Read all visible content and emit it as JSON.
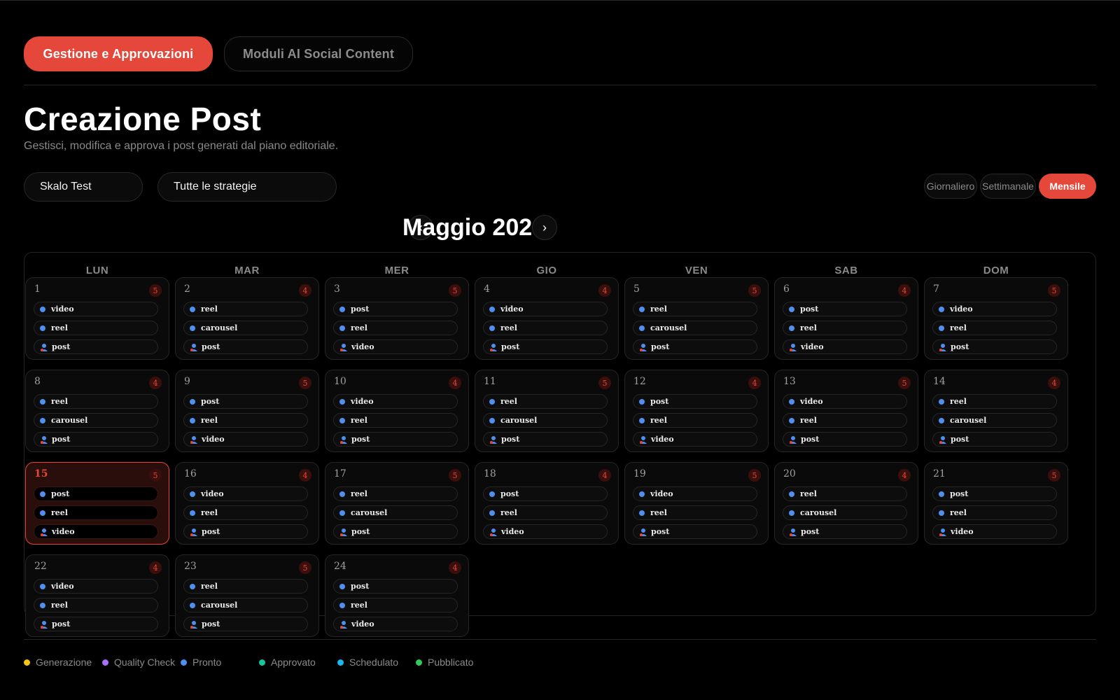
{
  "tabs": [
    {
      "label": "Gestione e Approvazioni",
      "active": true
    },
    {
      "label": "Moduli AI Social Content",
      "active": false
    }
  ],
  "page": {
    "title": "Creazione Post",
    "subtitle": "Gestisci, modifica e approva i post generati dal piano editoriale."
  },
  "filters": {
    "client": "Skalo Test",
    "strategy": "Tutte le strategie"
  },
  "views": {
    "day": "Giornaliero",
    "week": "Settimanale",
    "month": "Mensile",
    "selected": "month"
  },
  "calendar": {
    "month_title": "Maggio 2026",
    "prev_symbol": "‹",
    "next_symbol": "›",
    "weekdays": [
      "LUN",
      "MAR",
      "MER",
      "GIO",
      "VEN",
      "SAB",
      "DOM"
    ],
    "today": "15",
    "days": [
      {
        "day": "1",
        "count": "5",
        "posts": [
          "video",
          "reel",
          "post"
        ]
      },
      {
        "day": "2",
        "count": "4",
        "posts": [
          "reel",
          "carousel",
          "post"
        ]
      },
      {
        "day": "3",
        "count": "5",
        "posts": [
          "post",
          "reel",
          "video"
        ]
      },
      {
        "day": "4",
        "count": "4",
        "posts": [
          "video",
          "reel",
          "post"
        ]
      },
      {
        "day": "5",
        "count": "5",
        "posts": [
          "reel",
          "carousel",
          "post"
        ]
      },
      {
        "day": "6",
        "count": "4",
        "posts": [
          "post",
          "reel",
          "video"
        ]
      },
      {
        "day": "7",
        "count": "5",
        "posts": [
          "video",
          "reel",
          "post"
        ]
      },
      {
        "day": "8",
        "count": "4",
        "posts": [
          "reel",
          "carousel",
          "post"
        ]
      },
      {
        "day": "9",
        "count": "5",
        "posts": [
          "post",
          "reel",
          "video"
        ]
      },
      {
        "day": "10",
        "count": "4",
        "posts": [
          "video",
          "reel",
          "post"
        ]
      },
      {
        "day": "11",
        "count": "5",
        "posts": [
          "reel",
          "carousel",
          "post"
        ]
      },
      {
        "day": "12",
        "count": "4",
        "posts": [
          "post",
          "reel",
          "video"
        ]
      },
      {
        "day": "13",
        "count": "5",
        "posts": [
          "video",
          "reel",
          "post"
        ]
      },
      {
        "day": "14",
        "count": "4",
        "posts": [
          "reel",
          "carousel",
          "post"
        ]
      },
      {
        "day": "15",
        "count": "5",
        "posts": [
          "post",
          "reel",
          "video"
        ]
      },
      {
        "day": "16",
        "count": "4",
        "posts": [
          "video",
          "reel",
          "post"
        ]
      },
      {
        "day": "17",
        "count": "5",
        "posts": [
          "reel",
          "carousel",
          "post"
        ]
      },
      {
        "day": "18",
        "count": "4",
        "posts": [
          "post",
          "reel",
          "video"
        ]
      },
      {
        "day": "19",
        "count": "5",
        "posts": [
          "video",
          "reel",
          "post"
        ]
      },
      {
        "day": "20",
        "count": "4",
        "posts": [
          "reel",
          "carousel",
          "post"
        ]
      },
      {
        "day": "21",
        "count": "5",
        "posts": [
          "post",
          "reel",
          "video"
        ]
      },
      {
        "day": "22",
        "count": "4",
        "posts": [
          "video",
          "reel",
          "post"
        ]
      },
      {
        "day": "23",
        "count": "5",
        "posts": [
          "reel",
          "carousel",
          "post"
        ]
      },
      {
        "day": "24",
        "count": "4",
        "posts": [
          "post",
          "reel",
          "video"
        ]
      }
    ]
  },
  "legend": [
    {
      "label": "Generazione",
      "color": "#f5c518"
    },
    {
      "label": "Quality Check",
      "color": "#a970ff"
    },
    {
      "label": "Pronto",
      "color": "#4f8ff0"
    },
    {
      "label": "Approvato",
      "color": "#17c6a0"
    },
    {
      "label": "Schedulato",
      "color": "#1fb5f0"
    },
    {
      "label": "Pubblicato",
      "color": "#2ecc5a"
    }
  ],
  "colors": {
    "accent": "#e5483a",
    "post_dot": "#4f8ff0"
  },
  "icons": {
    "post_status": "dot-icon",
    "post_assignee": "avatar-icon",
    "prev": "chevron-left-icon",
    "next": "chevron-right-icon"
  }
}
